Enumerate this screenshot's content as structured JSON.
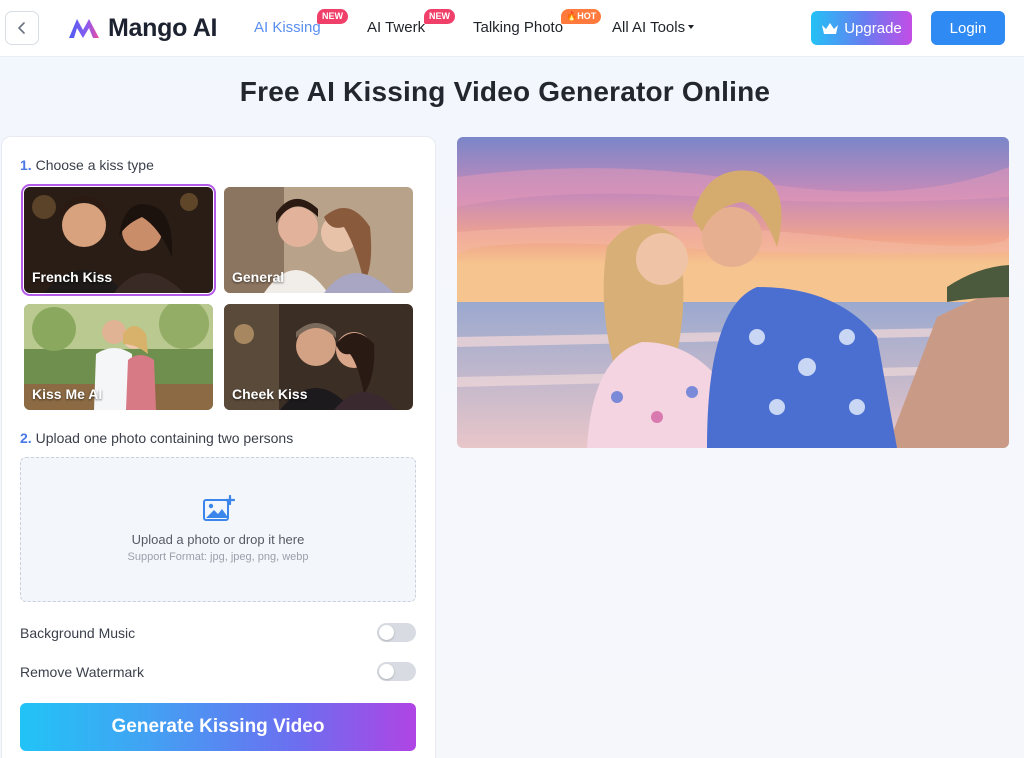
{
  "header": {
    "logo_text": "Mango AI",
    "nav": [
      {
        "label": "AI Kissing",
        "badge": "NEW",
        "active": true
      },
      {
        "label": "AI Twerk",
        "badge": "NEW",
        "active": false
      },
      {
        "label": "Talking Photo",
        "badge": "HOT",
        "active": false
      },
      {
        "label": "All AI Tools",
        "badge": "",
        "active": false
      }
    ],
    "upgrade_label": "Upgrade",
    "login_label": "Login"
  },
  "page": {
    "title": "Free AI Kissing Video Generator Online"
  },
  "form": {
    "step1": {
      "num": "1.",
      "label": "Choose a kiss type"
    },
    "kiss_types": [
      {
        "label": "French Kiss",
        "selected": true
      },
      {
        "label": "General",
        "selected": false
      },
      {
        "label": "Kiss Me AI",
        "selected": false
      },
      {
        "label": "Cheek Kiss",
        "selected": false
      }
    ],
    "step2": {
      "num": "2.",
      "label": "Upload one photo containing two persons"
    },
    "upload": {
      "text": "Upload a photo or drop it here",
      "formats": "Support Format: jpg, jpeg, png, webp"
    },
    "toggles": [
      {
        "label": "Background Music",
        "on": false
      },
      {
        "label": "Remove Watermark",
        "on": false
      }
    ],
    "generate_label": "Generate Kissing Video"
  },
  "colors": {
    "accent_blue": "#2f8af3",
    "active_nav": "#5a8ff0",
    "badge_new": "#f0406a",
    "badge_hot": "#ff7a3c"
  }
}
